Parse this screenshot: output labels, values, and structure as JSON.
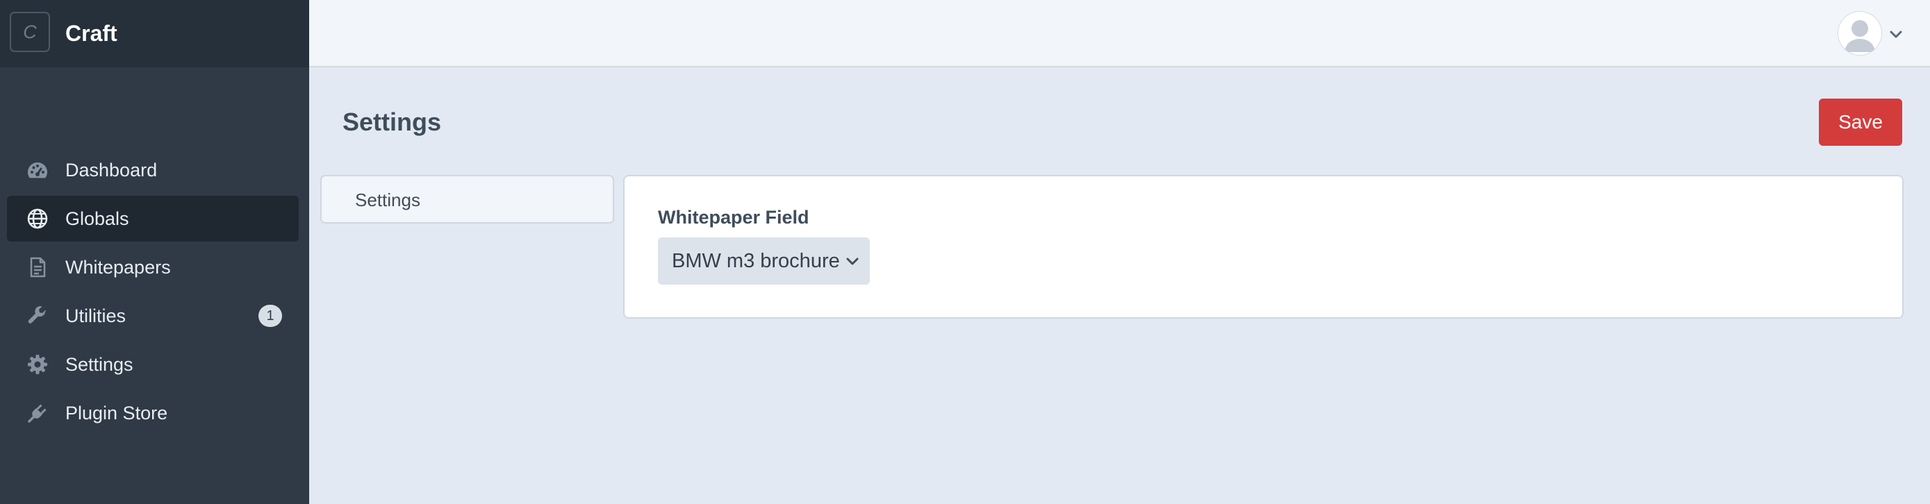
{
  "app": {
    "site_name": "Craft",
    "logo_letter": "C"
  },
  "sidebar": {
    "items": [
      {
        "label": "Dashboard",
        "icon": "gauge-icon",
        "active": false
      },
      {
        "label": "Globals",
        "icon": "globe-icon",
        "active": true
      },
      {
        "label": "Whitepapers",
        "icon": "document-icon",
        "active": false
      },
      {
        "label": "Utilities",
        "icon": "wrench-icon",
        "active": false,
        "badge": "1"
      },
      {
        "label": "Settings",
        "icon": "gear-icon",
        "active": false
      },
      {
        "label": "Plugin Store",
        "icon": "plug-icon",
        "active": false
      }
    ]
  },
  "header": {
    "account_icon": "user-avatar-icon",
    "account_menu_icon": "chevron-down-icon"
  },
  "page": {
    "title": "Settings",
    "save_label": "Save"
  },
  "subnav": {
    "items": [
      {
        "label": "Settings"
      }
    ]
  },
  "content": {
    "field_label": "Whitepaper Field",
    "select_value": "BMW m3 brochure"
  },
  "colors": {
    "sidebar_bg": "#2f3a46",
    "sidebar_header_bg": "#26303a",
    "active_item_bg": "#1f2831",
    "page_bg": "#e3e9f3",
    "save_button": "#d43c3c"
  }
}
